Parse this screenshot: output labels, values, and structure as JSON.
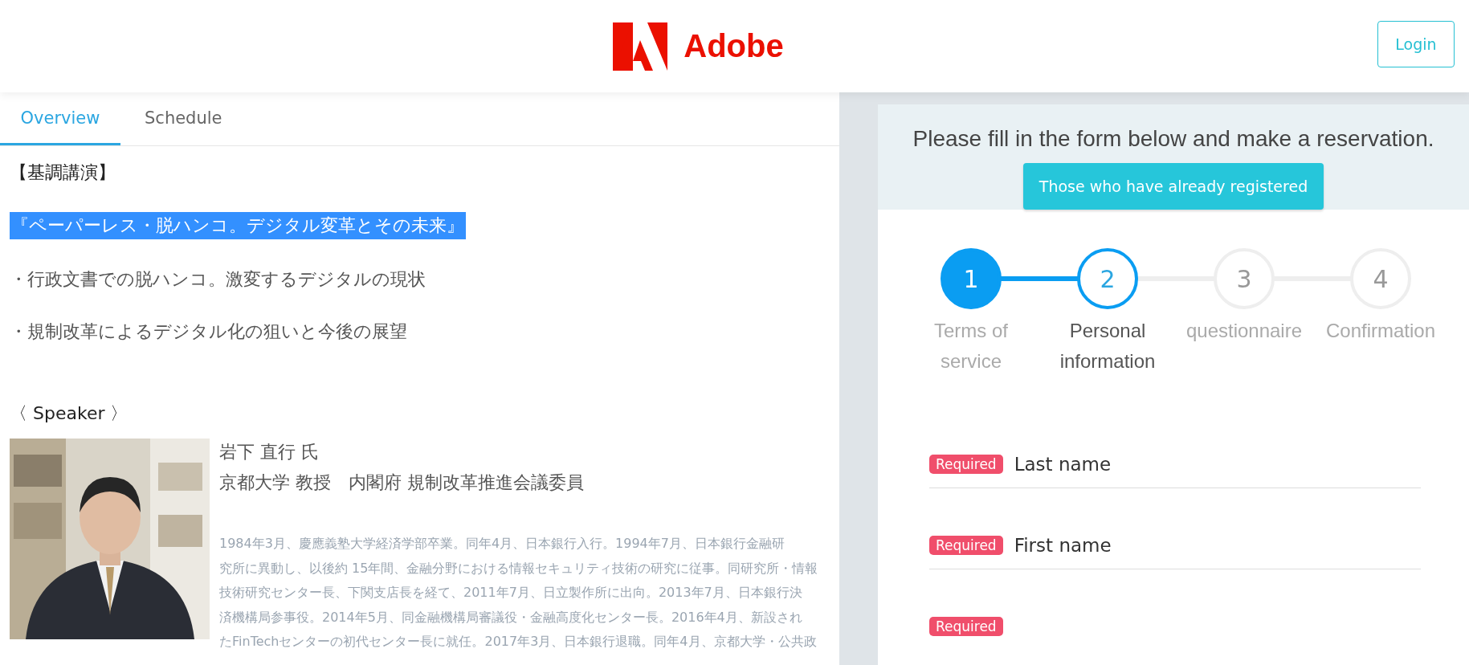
{
  "header": {
    "logo_text": "Adobe",
    "login": "Login"
  },
  "tabs": [
    {
      "label": "Overview",
      "selected": true
    },
    {
      "label": "Schedule",
      "selected": false
    }
  ],
  "keynote": {
    "heading": "【基調講演】",
    "title": {
      "text": "『ペーパーレス・脱ハンコ。デジタル変革とその未来』",
      "highlighted": true
    },
    "points": [
      "・行政文書での脱ハンコ。激変するデジタルの現状",
      "・規制改革によるデジタル化の狙いと今後の展望"
    ]
  },
  "speaker": {
    "heading": "〈 Speaker 〉",
    "name": "岩下 直行 氏",
    "affiliation": "京都大学 教授　内閣府 規制改革推進会議委員",
    "bio_lines": [
      "1984年3月、慶應義塾大学経済学部卒業。同年4月、日本銀行入行。1994年7月、日本銀行金融研",
      "究所に異動し、以後約 15年間、金融分野における情報セキュリティ技術の研究に従事。同研究所・情報",
      "技術研究センター長、下関支店長を経て、2011年7月、日立製作所に出向。2013年7月、日本銀行決",
      "済機構局参事役。2014年5月、同金融機構局審議役・金融高度化センター長。2016年4月、新設され",
      "たFinTechセンターの初代センター長に就任。2017年3月、日本銀行退職。同年4月、京都大学・公共政"
    ]
  },
  "reservation": {
    "prompt": "Please fill in the form below and make a reservation.",
    "registered_button": "Those who have already registered"
  },
  "steps": [
    {
      "number": "1",
      "label": "Terms of service",
      "completed": true,
      "current": false
    },
    {
      "number": "2",
      "label": "Personal information",
      "completed": false,
      "current": true
    },
    {
      "number": "3",
      "label": "questionnaire",
      "completed": false,
      "current": false
    },
    {
      "number": "4",
      "label": "Confirmation",
      "completed": false,
      "current": false
    }
  ],
  "fields": [
    {
      "badge": "Required",
      "label": "Last name"
    },
    {
      "badge": "Required",
      "label": "First name"
    },
    {
      "badge": "Required"
    }
  ]
}
